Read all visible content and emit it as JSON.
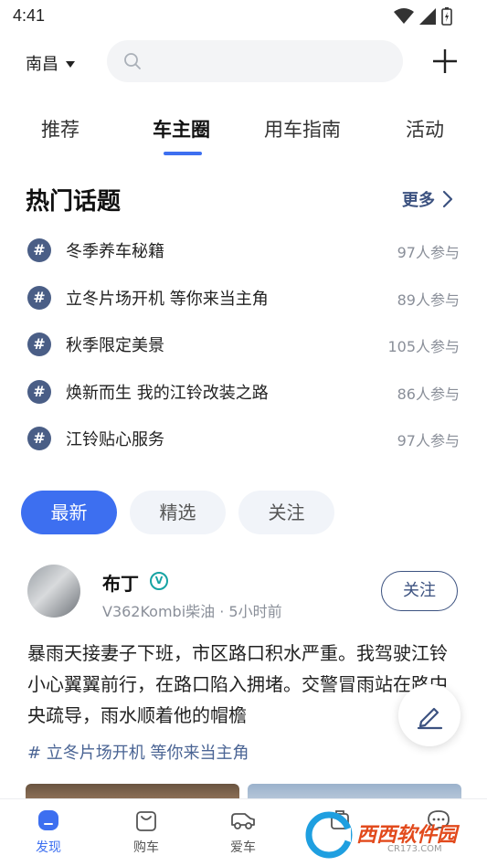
{
  "status_bar": {
    "time": "4:41"
  },
  "header": {
    "city": "南昌",
    "search_placeholder": ""
  },
  "tabs": [
    {
      "label": "推荐"
    },
    {
      "label": "车主圈"
    },
    {
      "label": "用车指南"
    },
    {
      "label": "活动"
    }
  ],
  "active_tab": "车主圈",
  "hot_topics": {
    "title": "热门话题",
    "more_label": "更多",
    "items": [
      {
        "name": "冬季养车秘籍",
        "count": "97人参与"
      },
      {
        "name": "立冬片场开机 等你来当主角",
        "count": "89人参与"
      },
      {
        "name": "秋季限定美景",
        "count": "105人参与"
      },
      {
        "name": "焕新而生 我的江铃改装之路",
        "count": "86人参与"
      },
      {
        "name": "江铃贴心服务",
        "count": "97人参与"
      }
    ]
  },
  "filters": [
    {
      "label": "最新"
    },
    {
      "label": "精选"
    },
    {
      "label": "关注"
    }
  ],
  "active_filter": "最新",
  "post": {
    "author": "布丁",
    "verified_badge": "V",
    "meta": "V362Kombi柴油 · 5小时前",
    "follow_label": "关注",
    "text": "暴雨天接妻子下班，市区路口积水严重。我驾驶江铃小心翼翼前行，在路口陷入拥堵。交警冒雨站在路中央疏导，雨水顺着他的帽檐",
    "topic": "# 立冬片场开机 等你来当主角"
  },
  "bottom_nav": [
    {
      "label": "发现",
      "icon": "discover-icon"
    },
    {
      "label": "购车",
      "icon": "shopping-bag-icon"
    },
    {
      "label": "爱车",
      "icon": "car-icon"
    },
    {
      "label": "",
      "icon": "store-icon"
    },
    {
      "label": "",
      "icon": "chat-icon"
    }
  ],
  "active_nav": "发现",
  "watermark": {
    "text": "西西软件园",
    "sub": "CR173.COM"
  },
  "colors": {
    "accent": "#3d6ff0",
    "topic_hash": "#4a5e86",
    "link": "#4a6494"
  }
}
